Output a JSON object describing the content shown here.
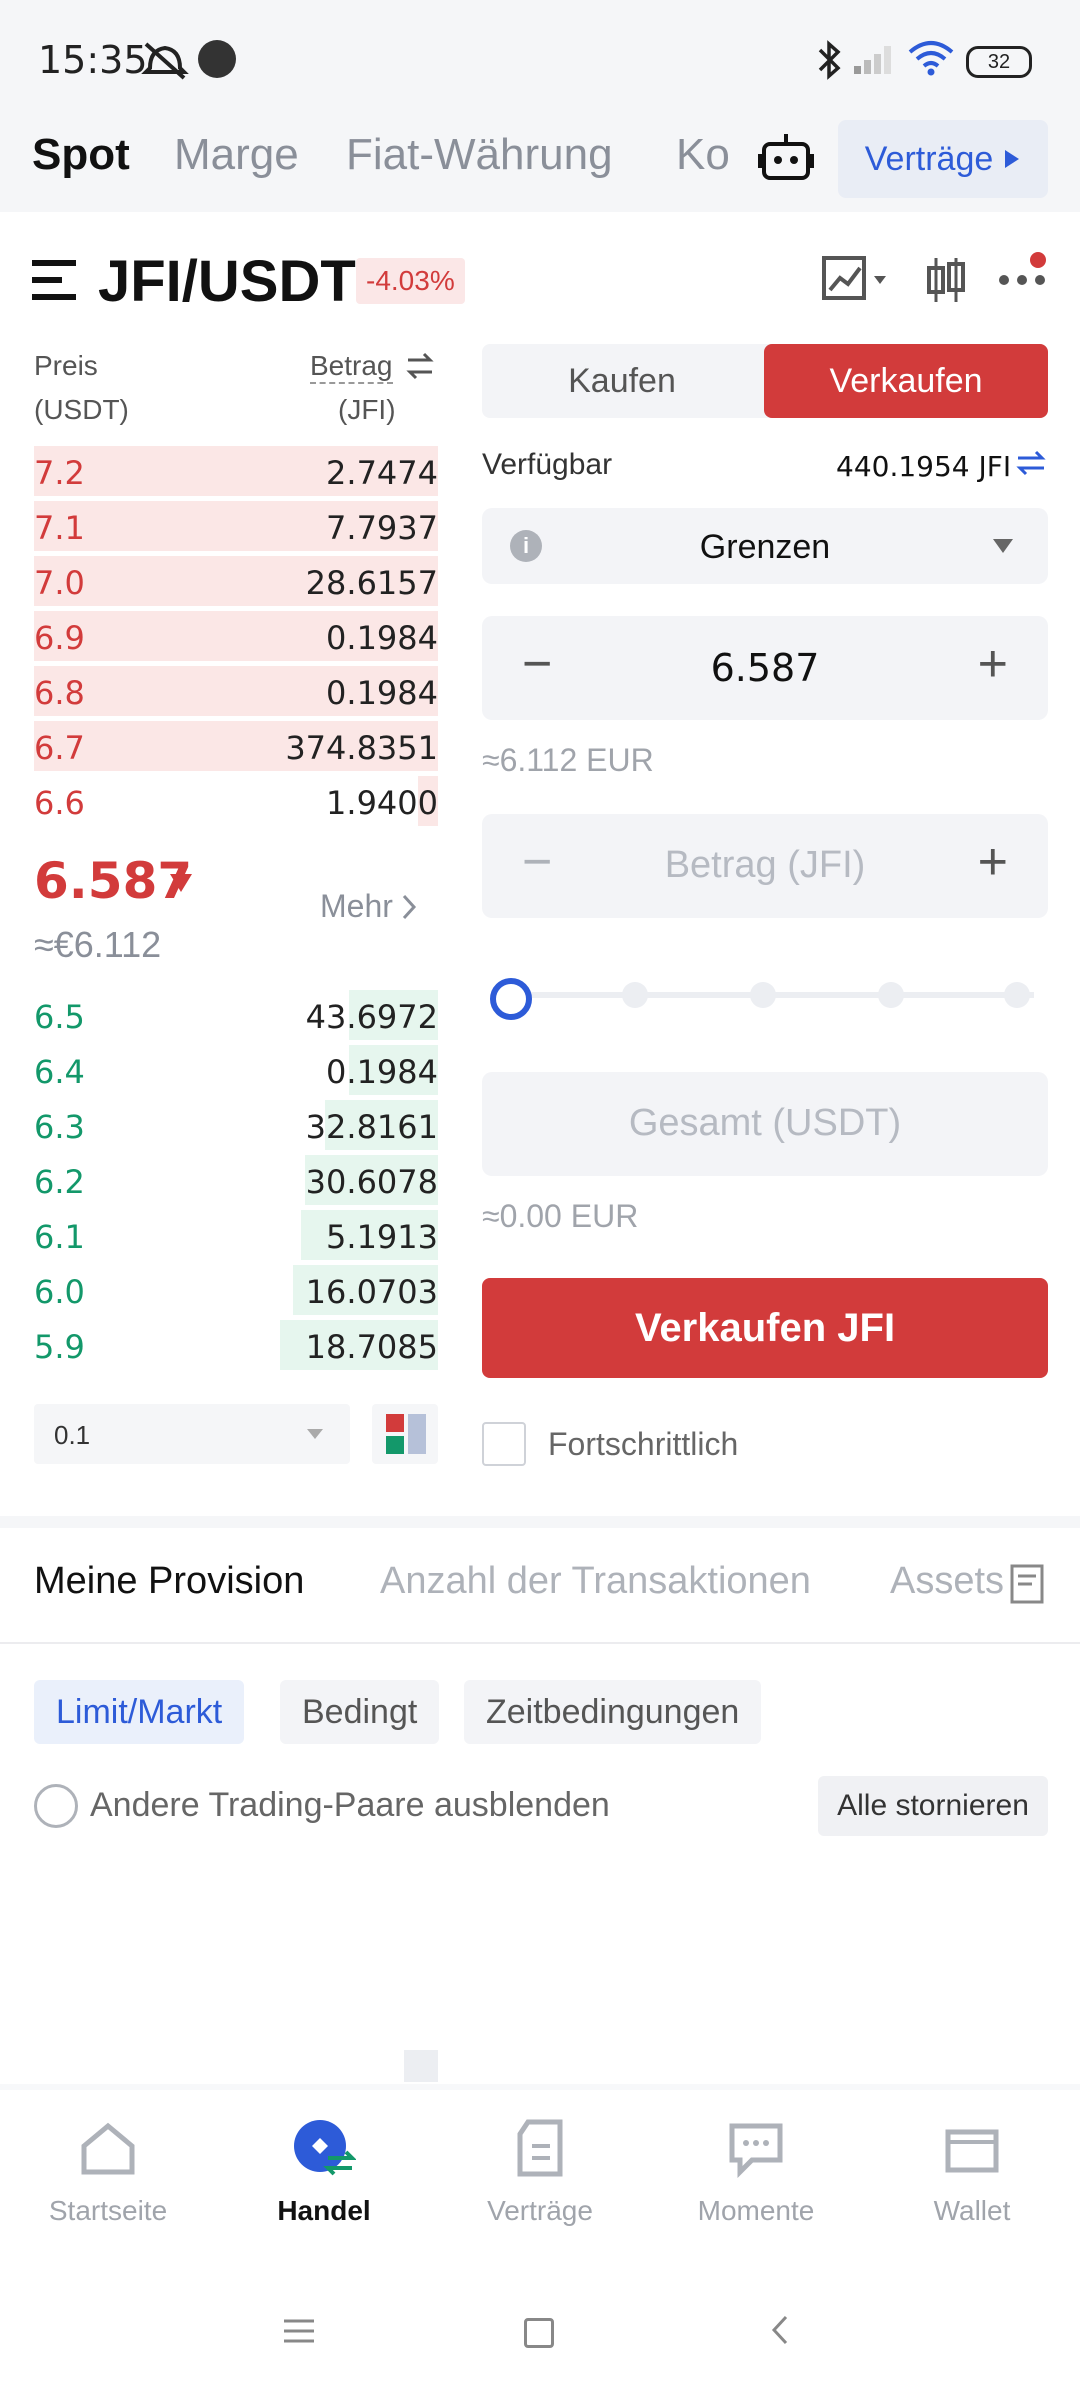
{
  "status": {
    "time": "15:35",
    "battery": "32"
  },
  "top_tabs": {
    "spot": "Spot",
    "margin": "Marge",
    "fiat": "Fiat-Währung",
    "ko": "Ko",
    "contracts": "Verträge"
  },
  "pair": {
    "name": "JFI/USDT",
    "change": "-4.03%"
  },
  "orderbook": {
    "price_label": "Preis",
    "price_unit": "(USDT)",
    "amount_label": "Betrag",
    "amount_unit": "(JFI)",
    "asks": [
      {
        "price": "7.2",
        "amount": "2.7474",
        "depth": 1.0
      },
      {
        "price": "7.1",
        "amount": "7.7937",
        "depth": 1.0
      },
      {
        "price": "7.0",
        "amount": "28.6157",
        "depth": 1.0
      },
      {
        "price": "6.9",
        "amount": "0.1984",
        "depth": 1.0
      },
      {
        "price": "6.8",
        "amount": "0.1984",
        "depth": 1.0
      },
      {
        "price": "6.7",
        "amount": "374.8351",
        "depth": 1.0
      },
      {
        "price": "6.6",
        "amount": "1.9400",
        "depth": 0.05
      }
    ],
    "last_price": "6.587",
    "last_price_eur": "≈€6.112",
    "more": "Mehr",
    "bids": [
      {
        "price": "6.5",
        "amount": "43.6972",
        "depth": 0.22
      },
      {
        "price": "6.4",
        "amount": "0.1984",
        "depth": 0.22
      },
      {
        "price": "6.3",
        "amount": "32.8161",
        "depth": 0.28
      },
      {
        "price": "6.2",
        "amount": "30.6078",
        "depth": 0.33
      },
      {
        "price": "6.1",
        "amount": "5.1913",
        "depth": 0.34
      },
      {
        "price": "6.0",
        "amount": "16.0703",
        "depth": 0.36
      },
      {
        "price": "5.9",
        "amount": "18.7085",
        "depth": 0.39
      }
    ],
    "precision": "0.1"
  },
  "form": {
    "buy": "Kaufen",
    "sell": "Verkaufen",
    "available_label": "Verfügbar",
    "available_value": "440.1954 JFI",
    "order_type": "Grenzen",
    "price_value": "6.587",
    "price_eur": "≈6.112 EUR",
    "amount_placeholder": "Betrag (JFI)",
    "total_placeholder": "Gesamt (USDT)",
    "total_eur": "≈0.00 EUR",
    "submit": "Verkaufen JFI",
    "advanced": "Fortschrittlich"
  },
  "orders_tabs": {
    "mine": "Meine Provision",
    "count": "Anzahl der Transaktionen",
    "assets": "Assets"
  },
  "chips": {
    "limit": "Limit/Markt",
    "conditional": "Bedingt",
    "time": "Zeitbedingungen"
  },
  "hide_pairs": "Andere Trading-Paare ausblenden",
  "cancel_all": "Alle stornieren",
  "nav": {
    "home": "Startseite",
    "trade": "Handel",
    "contracts": "Verträge",
    "moments": "Momente",
    "wallet": "Wallet"
  },
  "colors": {
    "red": "#d23b3b",
    "green": "#13986a",
    "blue": "#2d5bd8"
  }
}
